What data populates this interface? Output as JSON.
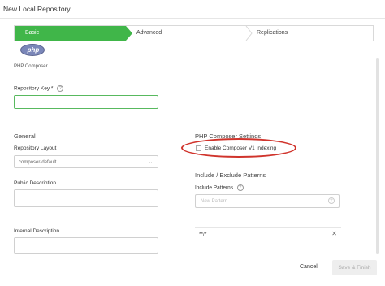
{
  "window": {
    "title": "New Local Repository"
  },
  "stepper": {
    "steps": [
      {
        "label": "Basic",
        "active": true
      },
      {
        "label": "Advanced",
        "active": false
      },
      {
        "label": "Replications",
        "active": false
      }
    ],
    "accent_color": "#40b649"
  },
  "package_type": {
    "logo_text": "php",
    "label": "PHP Composer"
  },
  "repository_key": {
    "label": "Repository Key *",
    "value": "",
    "help_icon": "question-circle-icon"
  },
  "general": {
    "title": "General",
    "layout_label": "Repository Layout",
    "layout_value": "composer-default",
    "public_description_label": "Public Description",
    "internal_description_label": "Internal Description"
  },
  "php_settings": {
    "title": "PHP Composer Settings",
    "enable_v1_indexing_label": "Enable Composer V1 Indexing",
    "enable_v1_indexing_checked": false,
    "highlight_color": "#d0342c"
  },
  "patterns": {
    "title": "Include / Exclude Patterns",
    "include_label": "Include Patterns",
    "new_pattern_placeholder": "New Pattern",
    "items": [
      "**/*"
    ]
  },
  "footer": {
    "cancel_label": "Cancel",
    "finish_label": "Save & Finish"
  }
}
